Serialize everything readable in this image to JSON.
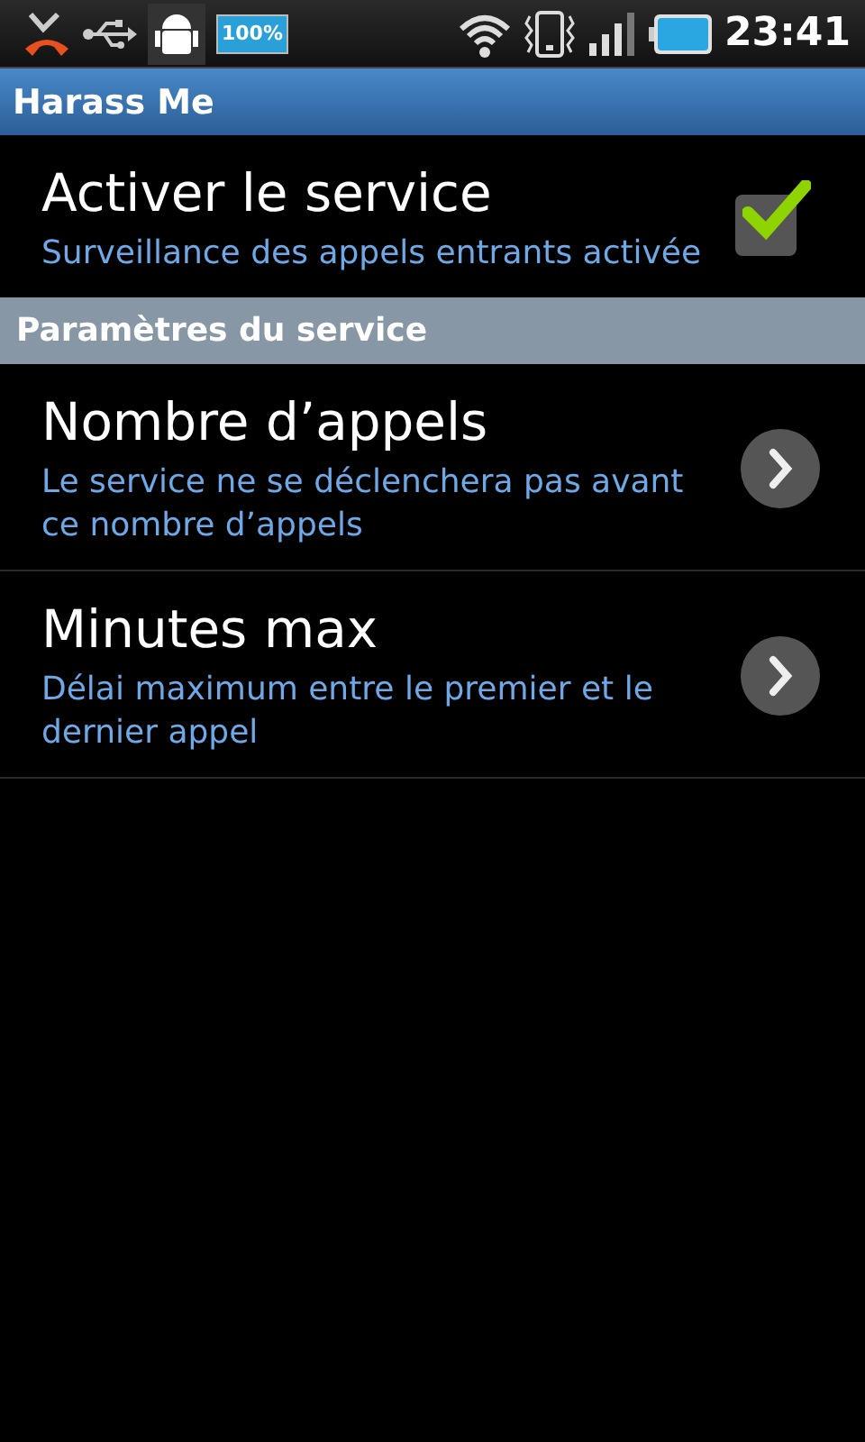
{
  "status_bar": {
    "battery_badge": "100%",
    "time": "23:41"
  },
  "title_bar": {
    "title": "Harass Me"
  },
  "sections": [
    {
      "kind": "items",
      "items": [
        {
          "kind": "checkbox",
          "title": "Activer le service",
          "summary": "Surveillance des appels entrants activée",
          "checked": true
        }
      ]
    },
    {
      "kind": "header",
      "title": "Paramètres du service"
    },
    {
      "kind": "items",
      "items": [
        {
          "kind": "link",
          "title": "Nombre d’appels",
          "summary": "Le service ne se déclenchera pas avant ce nombre d’appels"
        },
        {
          "kind": "link",
          "title": "Minutes max",
          "summary": "Délai maximum entre le premier et le dernier appel"
        }
      ]
    }
  ]
}
